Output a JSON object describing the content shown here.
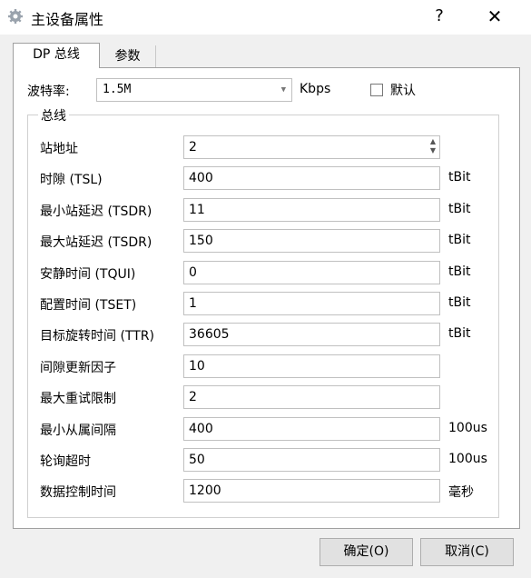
{
  "window": {
    "title": "主设备属性",
    "help": "?",
    "close": "✕"
  },
  "tabs": [
    {
      "label": "DP 总线",
      "active": true
    },
    {
      "label": "参数",
      "active": false
    }
  ],
  "baud": {
    "label": "波特率:",
    "value": "1.5M",
    "unit": "Kbps",
    "default_label": "默认",
    "default_checked": false
  },
  "group": {
    "title": "总线",
    "rows": [
      {
        "label": "站地址",
        "value": "2",
        "unit": "",
        "spinner": true
      },
      {
        "label": "时隙 (TSL)",
        "value": "400",
        "unit": "tBit"
      },
      {
        "label": "最小站延迟 (TSDR)",
        "value": "11",
        "unit": "tBit"
      },
      {
        "label": "最大站延迟 (TSDR)",
        "value": "150",
        "unit": "tBit"
      },
      {
        "label": "安静时间 (TQUI)",
        "value": "0",
        "unit": "tBit"
      },
      {
        "label": "配置时间 (TSET)",
        "value": "1",
        "unit": "tBit"
      },
      {
        "label": "目标旋转时间 (TTR)",
        "value": "36605",
        "unit": "tBit"
      },
      {
        "label": "间隙更新因子",
        "value": "10",
        "unit": ""
      },
      {
        "label": "最大重试限制",
        "value": "2",
        "unit": ""
      },
      {
        "label": "最小从属间隔",
        "value": "400",
        "unit": "100us"
      },
      {
        "label": "轮询超时",
        "value": "50",
        "unit": "100us"
      },
      {
        "label": "数据控制时间",
        "value": "1200",
        "unit": "毫秒"
      }
    ]
  },
  "buttons": {
    "ok": "确定(O)",
    "cancel": "取消(C)"
  }
}
